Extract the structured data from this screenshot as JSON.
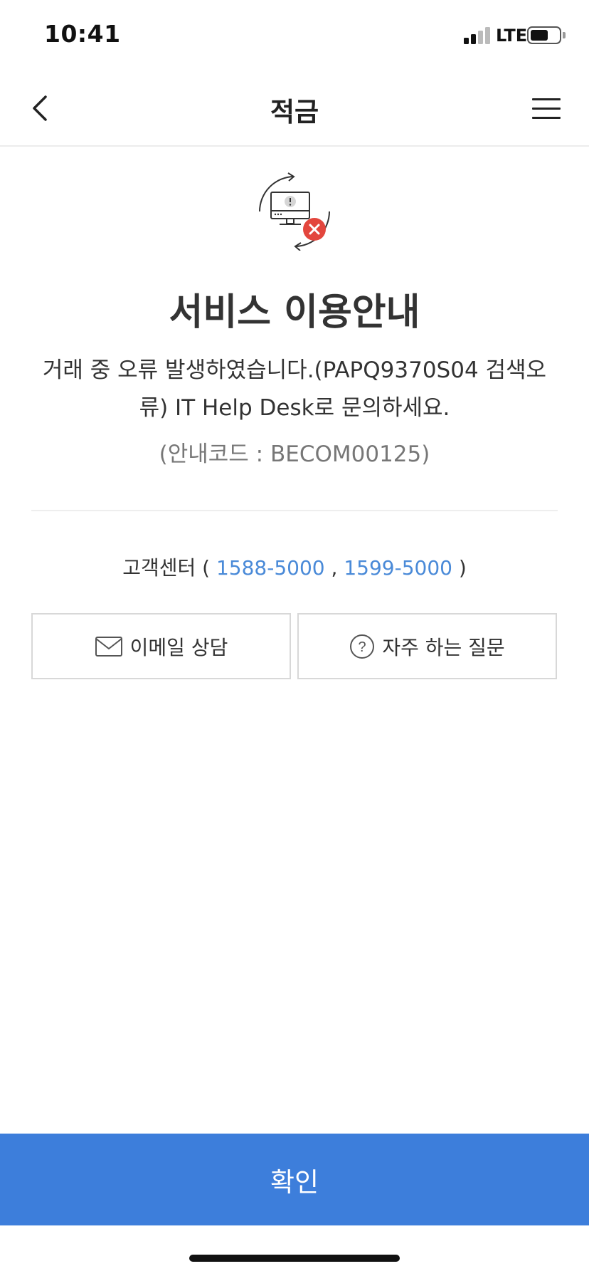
{
  "status_bar": {
    "time": "10:41",
    "network": "LTE"
  },
  "header": {
    "title": "적금",
    "back_icon": "chevron-left-icon",
    "menu_icon": "hamburger-menu-icon"
  },
  "main": {
    "illustration_icon": "computer-error-icon",
    "title": "서비스 이용안내",
    "message": "거래 중 오류 발생하였습니다.(PAPQ9370S04 검색오류) IT Help Desk로 문의하세요.",
    "guide_code": "(안내코드 : BECOM00125)"
  },
  "customer_center": {
    "label": "고객센터 (",
    "phone1": "1588-5000",
    "separator": ",",
    "phone2": "1599-5000",
    "close": ")"
  },
  "actions": {
    "email_label": "이메일 상담",
    "faq_label": "자주 하는 질문"
  },
  "footer": {
    "confirm_label": "확인"
  },
  "colors": {
    "accent": "#3d7edb",
    "link": "#4a8ad8",
    "error_red": "#e3463d"
  }
}
